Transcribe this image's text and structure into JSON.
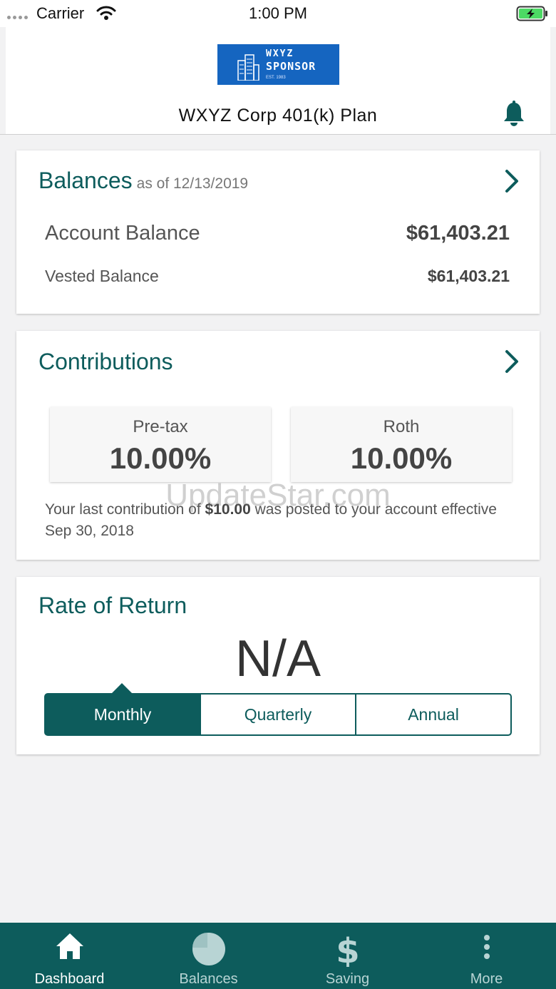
{
  "status_bar": {
    "carrier": "Carrier",
    "time": "1:00 PM"
  },
  "header": {
    "logo": {
      "line1": "WXYZ",
      "line2": "SPONSOR",
      "line3": "EST. 1983"
    },
    "plan_title": "WXYZ Corp 401(k) Plan"
  },
  "balances": {
    "title": "Balances",
    "as_of": "as of 12/13/2019",
    "account_label": "Account Balance",
    "account_value": "$61,403.21",
    "vested_label": "Vested Balance",
    "vested_value": "$61,403.21"
  },
  "contributions": {
    "title": "Contributions",
    "pretax_label": "Pre-tax",
    "pretax_value": "10.00%",
    "roth_label": "Roth",
    "roth_value": "10.00%",
    "note_prefix": "Your last contribution of ",
    "note_amount": "$10.00",
    "note_suffix": " was posted to your account effective Sep 30, 2018"
  },
  "rate_of_return": {
    "title": "Rate of Return",
    "value": "N/A",
    "tabs": [
      "Monthly",
      "Quarterly",
      "Annual"
    ],
    "selected": "Monthly"
  },
  "watermark": "UpdateStar.com",
  "tab_bar": {
    "items": [
      {
        "label": "Dashboard",
        "icon": "home-icon"
      },
      {
        "label": "Balances",
        "icon": "pie-chart-icon"
      },
      {
        "label": "Saving",
        "icon": "dollar-icon"
      },
      {
        "label": "More",
        "icon": "more-vertical-icon"
      }
    ],
    "active": "Dashboard"
  },
  "colors": {
    "brand": "#0d5c5c",
    "logo_blue": "#1565c0"
  }
}
